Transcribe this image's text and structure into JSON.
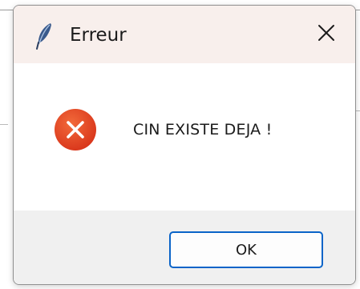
{
  "window": {
    "title": "Erreur",
    "app_icon": "feather-icon",
    "close_icon": "close-icon"
  },
  "content": {
    "icon": "error-icon",
    "message": "CIN EXISTE DEJA !"
  },
  "footer": {
    "ok_label": "OK"
  },
  "colors": {
    "titlebar_bg": "#f8efec",
    "footer_bg": "#f0f0f0",
    "error_red": "#e2401c",
    "button_border": "#0a64c8",
    "text": "#1b1b1b"
  }
}
